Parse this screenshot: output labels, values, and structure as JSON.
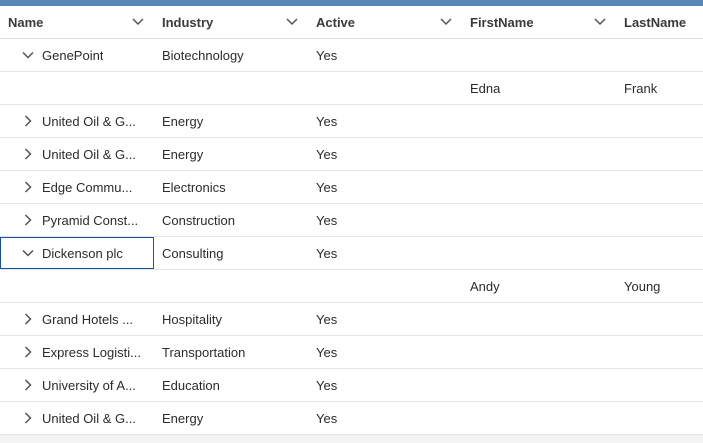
{
  "grid": {
    "columns": [
      {
        "label": "Name"
      },
      {
        "label": "Industry"
      },
      {
        "label": "Active"
      },
      {
        "label": "FirstName"
      },
      {
        "label": "LastName"
      }
    ],
    "rows": [
      {
        "type": "account",
        "expanded": true,
        "name": "GenePoint",
        "industry": "Biotechnology",
        "active": "Yes"
      },
      {
        "type": "contact",
        "first": "Edna",
        "last": "Frank"
      },
      {
        "type": "account",
        "expanded": false,
        "name": "United Oil & G...",
        "industry": "Energy",
        "active": "Yes"
      },
      {
        "type": "account",
        "expanded": false,
        "name": "United Oil & G...",
        "industry": "Energy",
        "active": "Yes"
      },
      {
        "type": "account",
        "expanded": false,
        "name": "Edge Commu...",
        "industry": "Electronics",
        "active": "Yes"
      },
      {
        "type": "account",
        "expanded": false,
        "name": "Pyramid Const...",
        "industry": "Construction",
        "active": "Yes"
      },
      {
        "type": "account",
        "expanded": true,
        "name": "Dickenson plc",
        "industry": "Consulting",
        "active": "Yes",
        "selected": true
      },
      {
        "type": "contact",
        "first": "Andy",
        "last": "Young"
      },
      {
        "type": "account",
        "expanded": false,
        "name": "Grand Hotels ...",
        "industry": "Hospitality",
        "active": "Yes"
      },
      {
        "type": "account",
        "expanded": false,
        "name": "Express Logisti...",
        "industry": "Transportation",
        "active": "Yes"
      },
      {
        "type": "account",
        "expanded": false,
        "name": "University of A...",
        "industry": "Education",
        "active": "Yes"
      },
      {
        "type": "account",
        "expanded": false,
        "name": "United Oil & G...",
        "industry": "Energy",
        "active": "Yes"
      }
    ]
  },
  "icons": {
    "sort": "chevron-down-icon",
    "collapsed": "chevron-right-icon",
    "expanded": "chevron-down-icon"
  },
  "colors": {
    "accent": "#5a86b7",
    "selection": "#1b5297",
    "border": "#e5e5e5"
  }
}
